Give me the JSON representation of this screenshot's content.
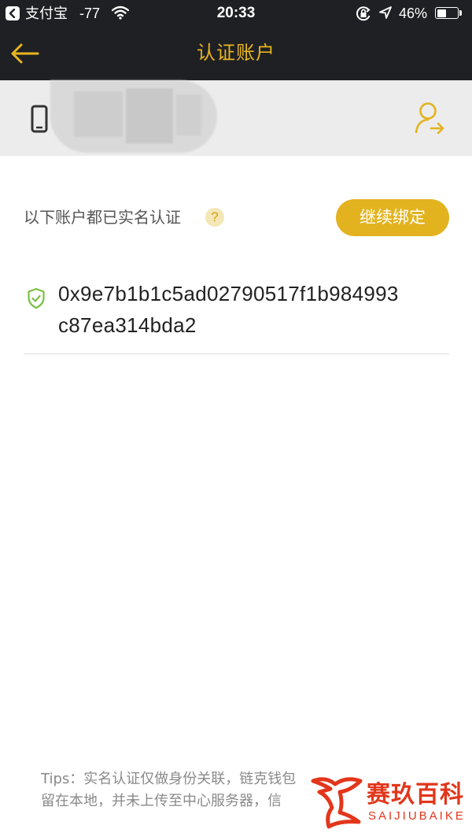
{
  "status_bar": {
    "back_app": "支付宝",
    "signal": "-77",
    "time": "20:33",
    "battery_text": "46%",
    "battery_level": 0.46
  },
  "nav": {
    "title": "认证账户"
  },
  "verified": {
    "label": "以下账户都已实名认证",
    "help": "?",
    "continue_button": "继续绑定"
  },
  "accounts": [
    {
      "address_line1": "0x9e7b1b1c5ad02790517f1b984993",
      "address_line2": "c87ea314bda2"
    }
  ],
  "tips": {
    "line1": "Tips：实名认证仅做身份关联，链克钱包",
    "line2": "留在本地，并未上传至中心服务器，信"
  },
  "watermark": {
    "brand": "赛玖百科",
    "sub": "SAIJIUBAIKE"
  },
  "colors": {
    "accent": "#e3b31f",
    "dark": "#1f2024",
    "verified_green": "#7bc043",
    "watermark_red": "#e2361b"
  }
}
